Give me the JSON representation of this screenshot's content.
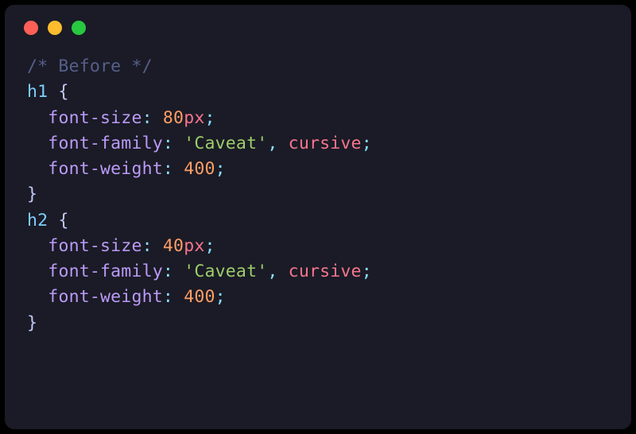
{
  "code": {
    "comment": "/* Before */",
    "rules": [
      {
        "selector": "h1",
        "declarations": [
          {
            "property": "font-size",
            "value_num": "80",
            "value_unit": "px"
          },
          {
            "property": "font-family",
            "value_string": "'Caveat'",
            "value_keyword": "cursive"
          },
          {
            "property": "font-weight",
            "value_num": "400"
          }
        ]
      },
      {
        "selector": "h2",
        "declarations": [
          {
            "property": "font-size",
            "value_num": "40",
            "value_unit": "px"
          },
          {
            "property": "font-family",
            "value_string": "'Caveat'",
            "value_keyword": "cursive"
          },
          {
            "property": "font-weight",
            "value_num": "400"
          }
        ]
      }
    ]
  },
  "punct": {
    "open_brace": "{",
    "close_brace": "}",
    "colon": ":",
    "semicolon": ";",
    "comma": ",",
    "space": " "
  }
}
